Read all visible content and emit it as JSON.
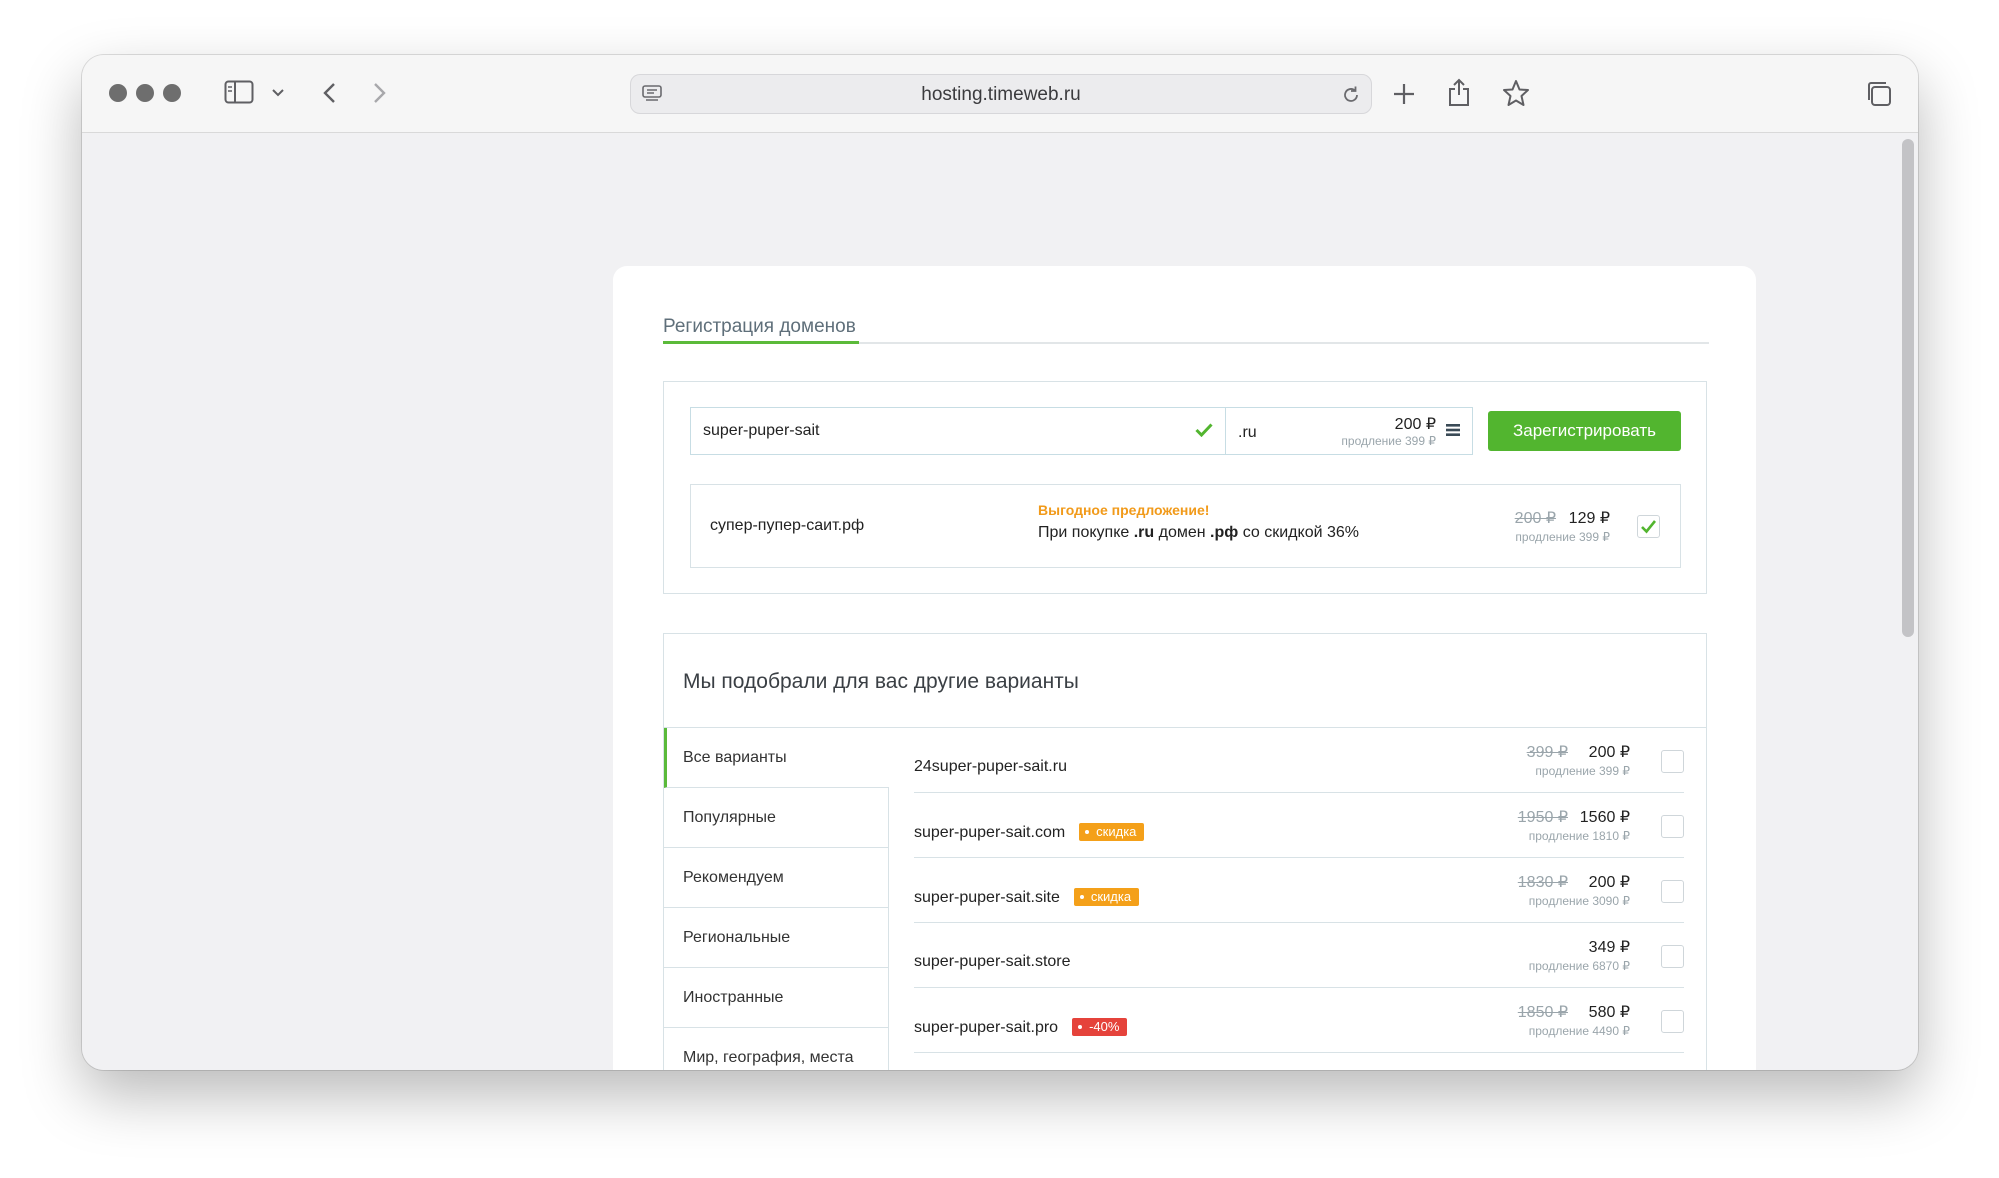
{
  "browser": {
    "url": "hosting.timeweb.ru"
  },
  "page": {
    "tab_label": "Регистрация доменов",
    "search": {
      "domain_value": "super-puper-sait",
      "zone": ".ru",
      "price": "200 ₽",
      "renewal": "продление 399 ₽",
      "register_label": "Зарегистрировать"
    },
    "offer": {
      "domain": "супер-пупер-саит.рф",
      "title": "Выгодное предложение!",
      "desc_prefix": "При покупке",
      "desc_zone1": ".ru",
      "desc_mid": "домен",
      "desc_zone2": ".рф",
      "desc_suffix": "со скидкой 36%",
      "old_price": "200 ₽",
      "new_price": "129 ₽",
      "renewal": "продление 399 ₽"
    },
    "variants": {
      "heading": "Мы подобрали для вас другие варианты",
      "categories": [
        {
          "label": "Все варианты"
        },
        {
          "label": "Популярные"
        },
        {
          "label": "Рекомендуем"
        },
        {
          "label": "Региональные"
        },
        {
          "label": "Иностранные"
        },
        {
          "label": "Мир, география, места"
        }
      ],
      "rows": [
        {
          "domain": "24super-puper-sait.ru",
          "badge": "",
          "old_price": "399 ₽",
          "new_price": "200 ₽",
          "renewal": "продление 399 ₽"
        },
        {
          "domain": "super-puper-sait.com",
          "badge": "скидка",
          "old_price": "1950 ₽",
          "new_price": "1560 ₽",
          "renewal": "продление 1810 ₽"
        },
        {
          "domain": "super-puper-sait.site",
          "badge": "скидка",
          "old_price": "1830 ₽",
          "new_price": "200 ₽",
          "renewal": "продление 3090 ₽"
        },
        {
          "domain": "super-puper-sait.store",
          "badge": "",
          "old_price": "",
          "new_price": "349 ₽",
          "renewal": "продление 6870 ₽"
        },
        {
          "domain": "super-puper-sait.pro",
          "badge": "-40%",
          "old_price": "1850 ₽",
          "new_price": "580 ₽",
          "renewal": "продление 4490 ₽"
        }
      ]
    }
  },
  "colors": {
    "accent_green": "#52b52f",
    "badge_orange": "#f4a019",
    "badge_red": "#e5433b",
    "offer_title": "#f19a1a"
  }
}
